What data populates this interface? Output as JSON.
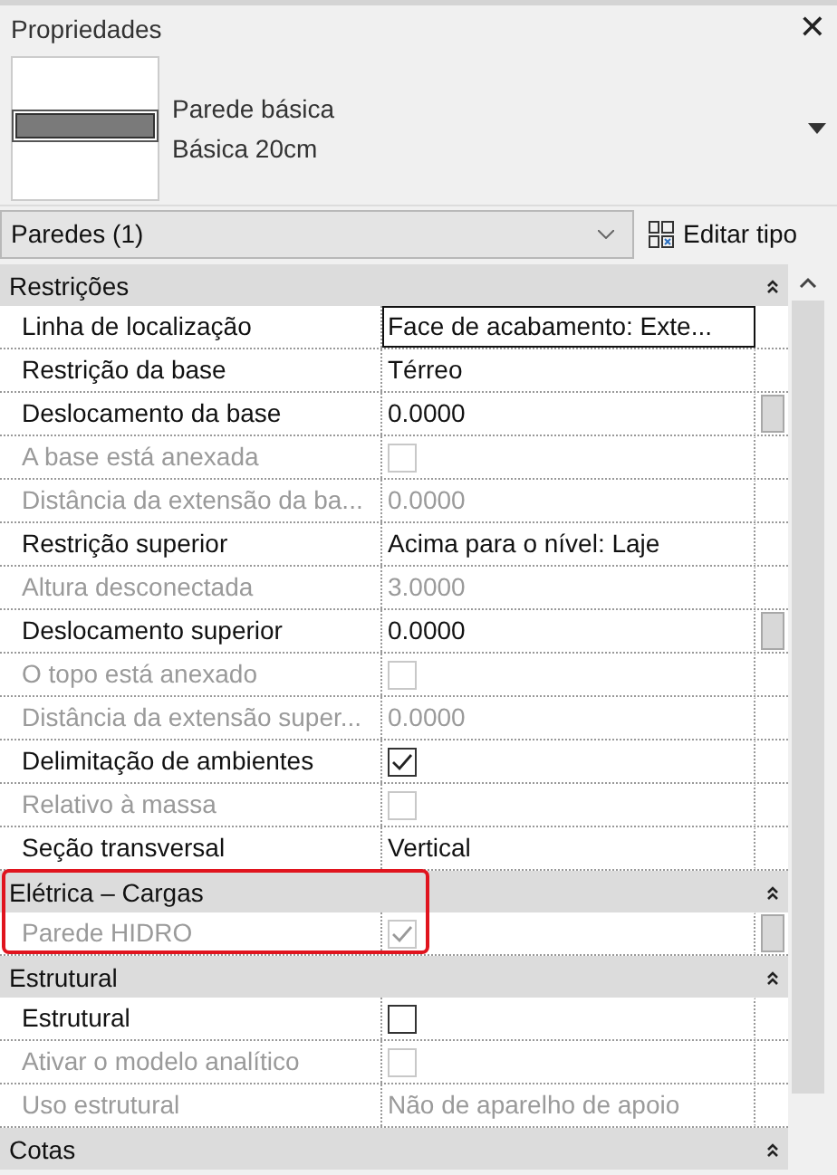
{
  "window": {
    "title": "Propriedades",
    "close": "✕"
  },
  "type_selector": {
    "family": "Parede básica",
    "type": "Básica 20cm"
  },
  "filter": {
    "value": "Paredes (1)",
    "edit_type": "Editar tipo"
  },
  "groups": [
    {
      "title": "Restrições",
      "highlighted": false,
      "rows": [
        {
          "name": "Linha de localização",
          "kind": "text",
          "value": "Face de acabamento: Exte...",
          "disabled": false,
          "focused": true,
          "spinner": false
        },
        {
          "name": "Restrição da base",
          "kind": "text",
          "value": "Térreo",
          "disabled": false,
          "focused": false,
          "spinner": false
        },
        {
          "name": "Deslocamento da base",
          "kind": "text",
          "value": "0.0000",
          "disabled": false,
          "focused": false,
          "spinner": true
        },
        {
          "name": "A base está anexada",
          "kind": "checkbox",
          "checked": false,
          "disabled": true,
          "focused": false,
          "spinner": false
        },
        {
          "name": "Distância da extensão da ba...",
          "kind": "text",
          "value": "0.0000",
          "disabled": true,
          "focused": false,
          "spinner": false
        },
        {
          "name": "Restrição superior",
          "kind": "text",
          "value": "Acima para o nível: Laje",
          "disabled": false,
          "focused": false,
          "spinner": false
        },
        {
          "name": "Altura desconectada",
          "kind": "text",
          "value": "3.0000",
          "disabled": true,
          "focused": false,
          "spinner": false
        },
        {
          "name": "Deslocamento superior",
          "kind": "text",
          "value": "0.0000",
          "disabled": false,
          "focused": false,
          "spinner": true
        },
        {
          "name": "O topo está anexado",
          "kind": "checkbox",
          "checked": false,
          "disabled": true,
          "focused": false,
          "spinner": false
        },
        {
          "name": "Distância da extensão super...",
          "kind": "text",
          "value": "0.0000",
          "disabled": true,
          "focused": false,
          "spinner": false
        },
        {
          "name": "Delimitação de ambientes",
          "kind": "checkbox",
          "checked": true,
          "disabled": false,
          "focused": false,
          "spinner": false
        },
        {
          "name": "Relativo à massa",
          "kind": "checkbox",
          "checked": false,
          "disabled": true,
          "focused": false,
          "spinner": false
        },
        {
          "name": "Seção transversal",
          "kind": "text",
          "value": "Vertical",
          "disabled": false,
          "focused": false,
          "spinner": false
        }
      ]
    },
    {
      "title": "Elétrica – Cargas",
      "highlighted": true,
      "rows": [
        {
          "name": "Parede HIDRO",
          "kind": "checkbox",
          "checked": true,
          "disabled": true,
          "focused": false,
          "spinner": true
        }
      ]
    },
    {
      "title": "Estrutural",
      "highlighted": false,
      "rows": [
        {
          "name": "Estrutural",
          "kind": "checkbox",
          "checked": false,
          "disabled": false,
          "focused": false,
          "spinner": false
        },
        {
          "name": "Ativar o modelo analítico",
          "kind": "checkbox",
          "checked": false,
          "disabled": true,
          "focused": false,
          "spinner": false
        },
        {
          "name": "Uso estrutural",
          "kind": "text",
          "value": "Não de aparelho de apoio",
          "disabled": true,
          "focused": false,
          "spinner": false
        }
      ]
    },
    {
      "title": "Cotas",
      "highlighted": false
    }
  ]
}
